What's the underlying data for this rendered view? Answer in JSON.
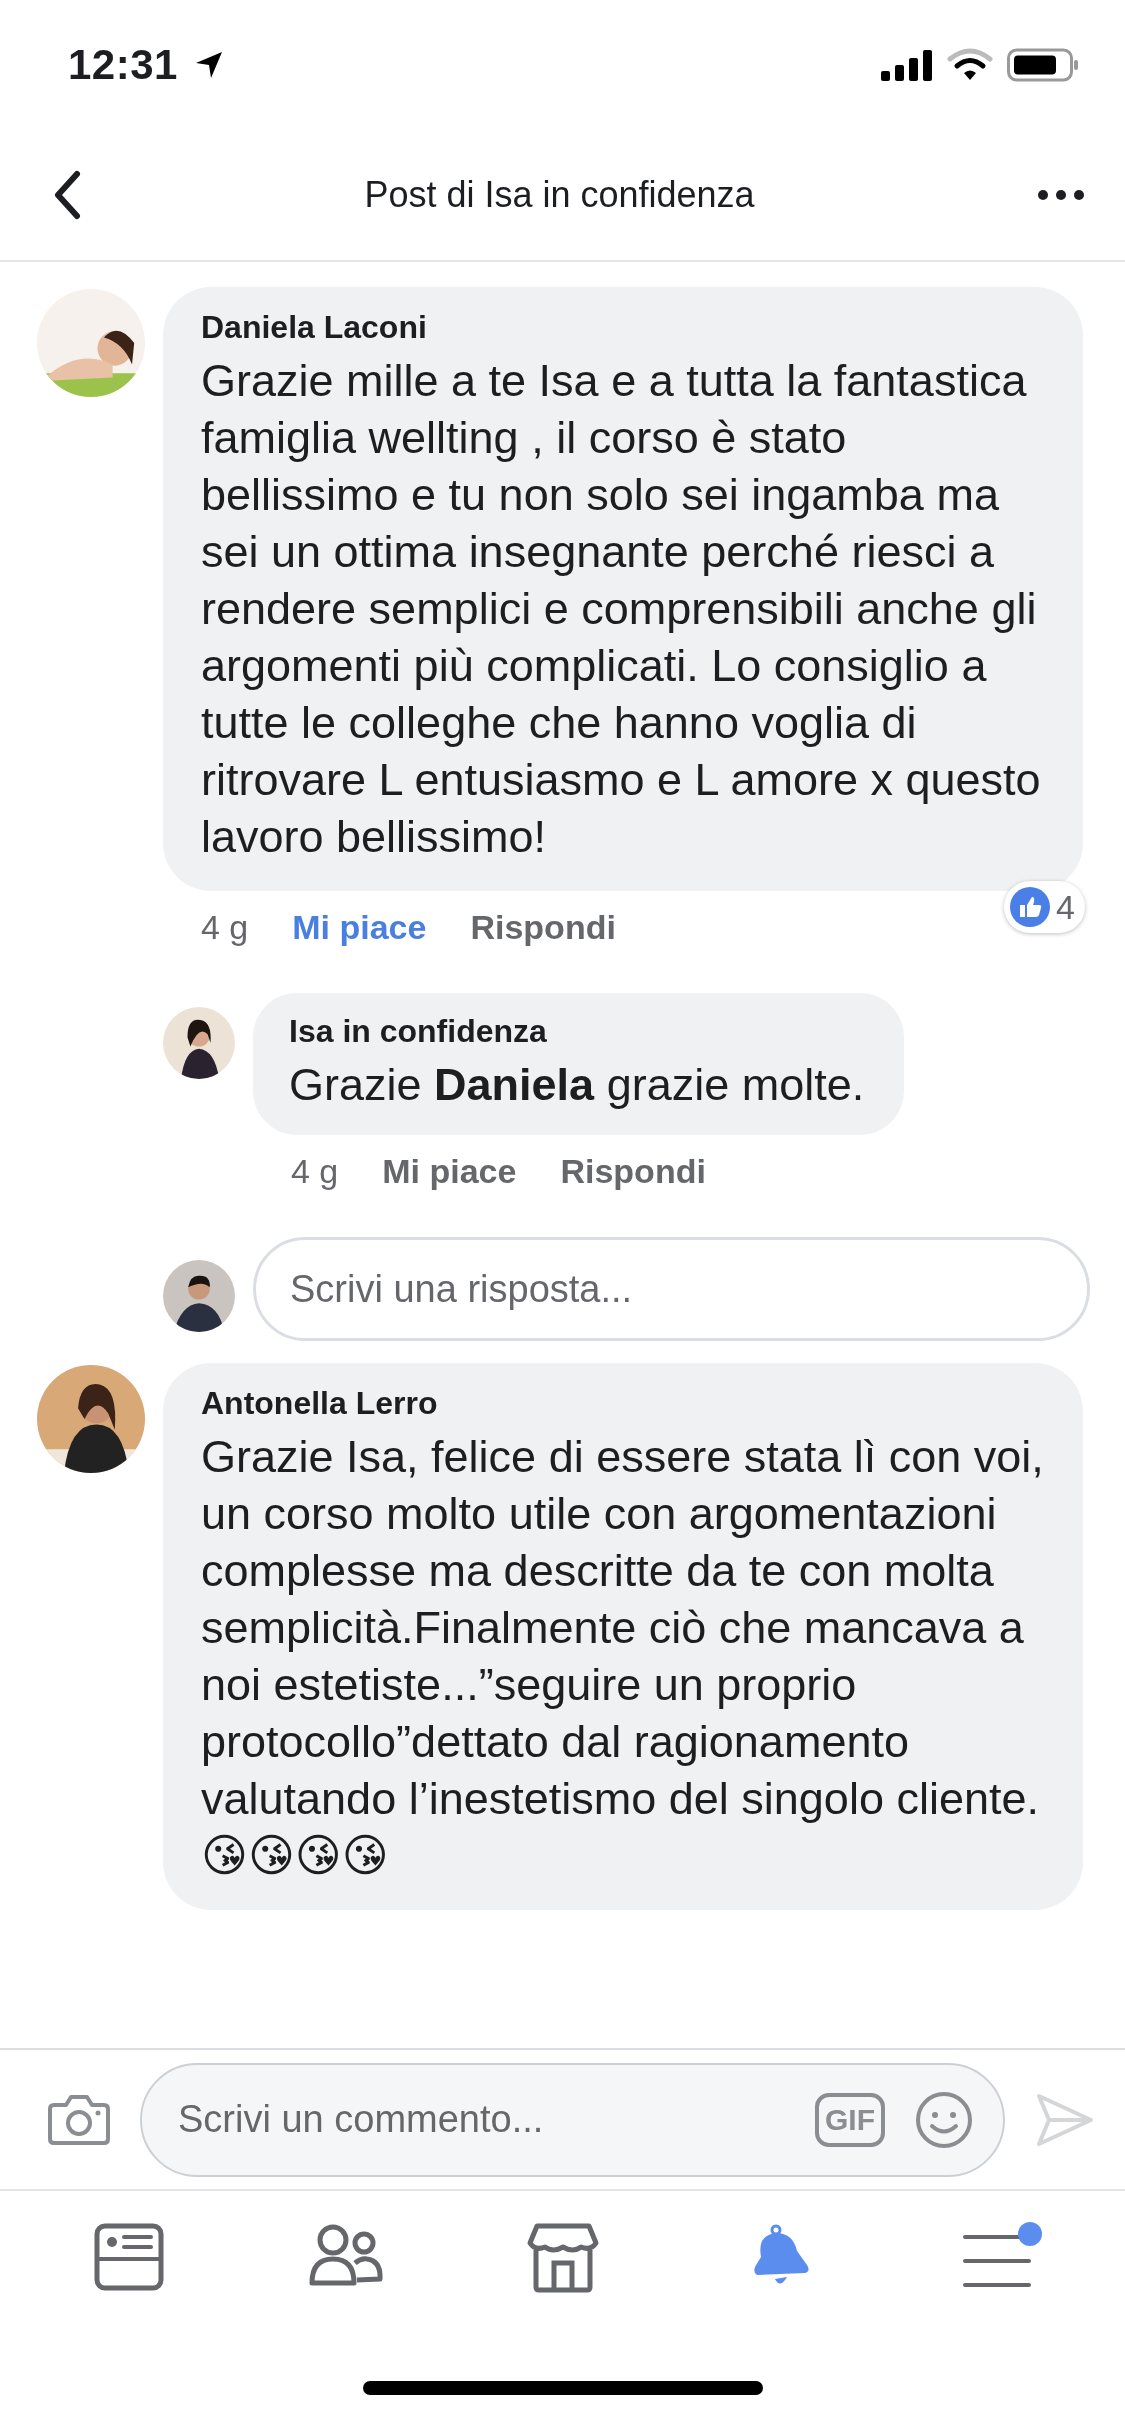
{
  "status_bar": {
    "time": "12:31"
  },
  "header": {
    "title": "Post di Isa in confidenza"
  },
  "comments": [
    {
      "author": "Daniela Laconi",
      "text": "Grazie mille a te Isa e a tutta la fantastica famiglia wellting , il corso è stato bellissimo e tu non solo sei ingamba ma sei un ottima insegnante perché riesci a rendere semplici e comprensibili anche gli argomenti più complicati. Lo consiglio a tutte le colleghe che hanno voglia di ritrovare L entusiasmo e L amore x questo lavoro bellissimo!",
      "time": "4 g",
      "like_label": "Mi piace",
      "reply_label": "Rispondi",
      "liked": true,
      "reaction_count": "4",
      "replies": [
        {
          "author": "Isa in confidenza",
          "text": "Grazie **Daniela** grazie molte.",
          "time": "4 g",
          "like_label": "Mi piace",
          "reply_label": "Rispondi",
          "liked": false
        }
      ],
      "reply_field": {
        "placeholder": "Scrivi una risposta..."
      }
    },
    {
      "author": "Antonella Lerro",
      "text": "Grazie Isa, felice di essere stata lì con voi, un corso molto utile con argomentazioni complesse ma descritte da te con molta semplicità.Finalmente ciò che mancava a noi estetiste...”seguire un proprio protocollo”dettato dal ragionamento valutando l’inestetismo del singolo cliente.😘😘😘😘"
    }
  ],
  "composer": {
    "placeholder": "Scrivi un commento...",
    "gif_label": "GIF"
  },
  "tab_bar": [
    {
      "kind": "news",
      "selected": false,
      "badge": false
    },
    {
      "kind": "friends",
      "selected": false,
      "badge": false
    },
    {
      "kind": "marketplace",
      "selected": false,
      "badge": false
    },
    {
      "kind": "notifications",
      "selected": true,
      "badge": false
    },
    {
      "kind": "menu",
      "selected": false,
      "badge": true
    }
  ]
}
